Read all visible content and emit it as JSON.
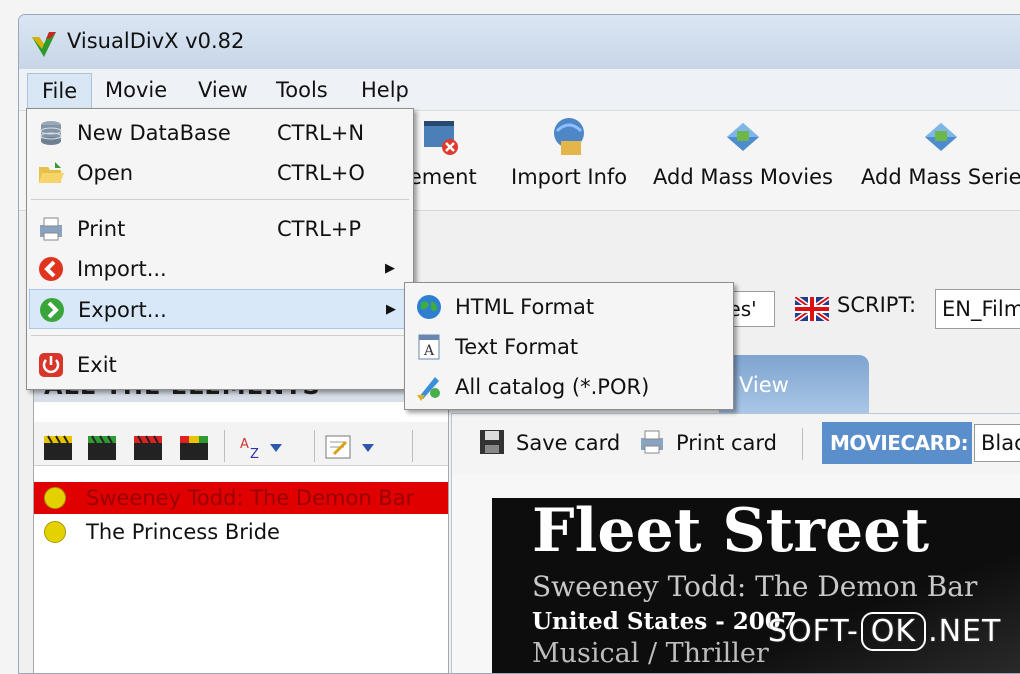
{
  "window": {
    "title": "VisualDivX v0.82"
  },
  "menubar": {
    "items": [
      "File",
      "Movie",
      "View",
      "Tools",
      "Help"
    ]
  },
  "toolbar": {
    "items": [
      {
        "label": "lement",
        "icon": "delete-element-icon"
      },
      {
        "label": "Import Info",
        "icon": "import-info-icon"
      },
      {
        "label": "Add Mass Movies",
        "icon": "add-mass-movies-icon"
      },
      {
        "label": "Add Mass Serie",
        "icon": "add-mass-series-icon"
      }
    ]
  },
  "bar2": {
    "lang_value": "ses'",
    "script_label": "SCRIPT:",
    "script_value": "EN_Film"
  },
  "file_menu": {
    "items": [
      {
        "label": "New DataBase",
        "shortcut": "CTRL+N"
      },
      {
        "label": "Open",
        "shortcut": "CTRL+O"
      },
      {
        "label": "Print",
        "shortcut": "CTRL+P"
      },
      {
        "label": "Import...",
        "submenu": true
      },
      {
        "label": "Export...",
        "submenu": true,
        "highlighted": true
      },
      {
        "label": "Exit"
      }
    ]
  },
  "export_menu": {
    "items": [
      {
        "label": "HTML Format"
      },
      {
        "label": "Text Format"
      },
      {
        "label": "All catalog (*.POR)"
      }
    ]
  },
  "left_panel": {
    "header": "ALL THE ELEMENTS",
    "list": [
      {
        "title": "Sweeney Todd: The Demon Bar",
        "selected": true
      },
      {
        "title": "The Princess Bride",
        "selected": false
      }
    ]
  },
  "right_panel": {
    "tab_label": "View",
    "save_card": "Save card",
    "print_card": "Print card",
    "moviecard_label": "MOVIECARD:",
    "moviecard_value": "Blac",
    "card": {
      "title": "Fleet Street",
      "subtitle": "Sweeney Todd: The Demon Bar",
      "country_year": "United States - 2007",
      "genre": "Musical / Thriller"
    }
  },
  "watermark": {
    "left": "SOFT-",
    "mid": "OK",
    "right": ".NET"
  },
  "colors": {
    "selection_red": "#e10000",
    "menu_highlight": "#d8e8f8",
    "moviecard_blue": "#5b8fcb"
  }
}
